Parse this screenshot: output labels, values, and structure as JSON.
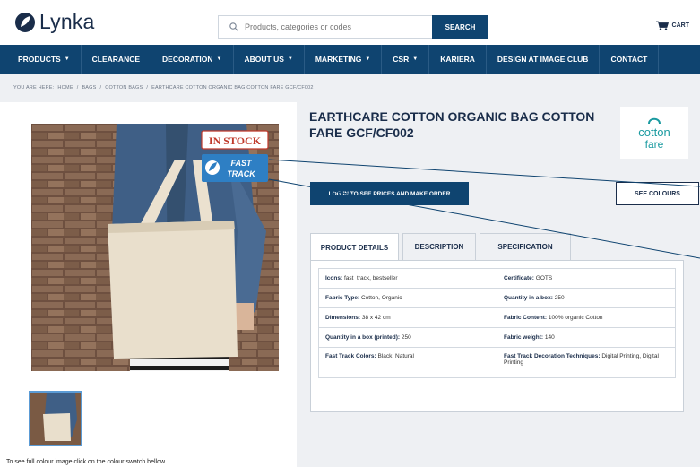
{
  "header": {
    "logo_text": "Lynka",
    "search_placeholder": "Products, categories or codes",
    "search_button": "SEARCH",
    "cart_label": "CART"
  },
  "nav": [
    {
      "label": "PRODUCTS",
      "dropdown": true
    },
    {
      "label": "CLEARANCE",
      "dropdown": false
    },
    {
      "label": "DECORATION",
      "dropdown": true
    },
    {
      "label": "ABOUT US",
      "dropdown": true
    },
    {
      "label": "MARKETING",
      "dropdown": true
    },
    {
      "label": "CSR",
      "dropdown": true
    },
    {
      "label": "KARIERA",
      "dropdown": false
    },
    {
      "label": "DESIGN AT IMAGE CLUB",
      "dropdown": false
    },
    {
      "label": "CONTACT",
      "dropdown": false
    }
  ],
  "breadcrumb": [
    "YOU ARE HERE:",
    "HOME",
    "/",
    "BAGS",
    "/",
    "COTTON BAGS",
    "/",
    "EARTHCARE COTTON ORGANIC BAG COTTON FARE GCF/CF002"
  ],
  "product": {
    "title": "EARTHCARE COTTON ORGANIC BAG COTTON FARE GCF/CF002",
    "in_stock_badge": "IN STOCK",
    "fast_track_badge_line1": "FAST",
    "fast_track_badge_line2": "TRACK",
    "brand_logo_text1": "cotton",
    "brand_logo_text2": "fare",
    "swatch_note": "To see full colour image click on the colour swatch bellow",
    "login_button": "LOG IN TO SEE PRICES AND MAKE ORDER",
    "colours_button": "SEE COLOURS"
  },
  "tabs": [
    "PRODUCT DETAILS",
    "DESCRIPTION",
    "SPECIFICATION"
  ],
  "details": [
    [
      {
        "k": "Icons:",
        "v": "fast_track, bestseller"
      },
      {
        "k": "Certificate:",
        "v": "GOTS"
      }
    ],
    [
      {
        "k": "Fabric Type:",
        "v": "Cotton, Organic"
      },
      {
        "k": "Quantity in a box:",
        "v": "250"
      }
    ],
    [
      {
        "k": "Dimensions:",
        "v": "38 x 42 cm"
      },
      {
        "k": "Fabric Content:",
        "v": "100% organic Cotton"
      }
    ],
    [
      {
        "k": "Quantity in a box (printed):",
        "v": "250"
      },
      {
        "k": "Fabric weight:",
        "v": "140"
      }
    ],
    [
      {
        "k": "Fast Track Colors:",
        "v": "Black, Natural"
      },
      {
        "k": "Fast Track Decoration Techniques:",
        "v": "Digital Printing, Digital Printing"
      }
    ]
  ],
  "colors": {
    "brand_navy": "#0f4470",
    "in_stock_red": "#c0392b",
    "fast_track_blue": "#2e7fc4",
    "cotton_fare_teal": "#1a9aa0"
  }
}
